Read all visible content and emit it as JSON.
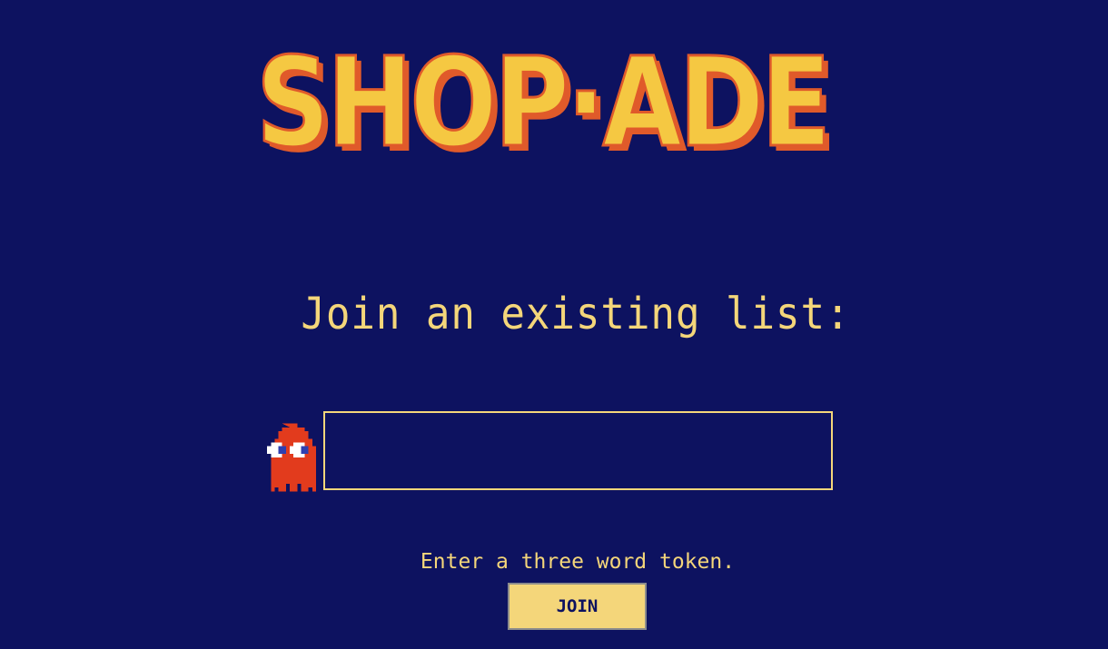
{
  "app": {
    "logo_text": "SHOP·ADE",
    "colors": {
      "background": "#0d1260",
      "accent": "#f4d67a",
      "logo_fill": "#f5c842",
      "logo_shadow": "#e05a2a",
      "ghost": "#e23b1d"
    }
  },
  "main": {
    "heading": "Join an existing list:",
    "ghost_icon": "ghost-icon",
    "token_input": {
      "value": "",
      "placeholder": ""
    },
    "hint": "Enter a three word token.",
    "join_label": "JOIN"
  }
}
